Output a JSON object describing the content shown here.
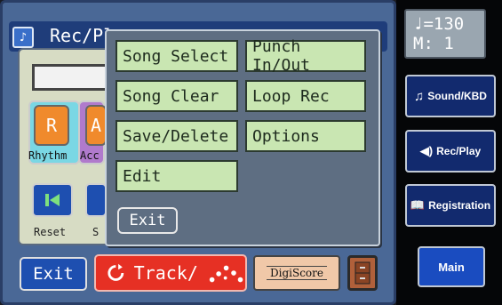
{
  "window": {
    "title": "Rec/Pl"
  },
  "parts": {
    "rhythm_key": "R",
    "accomp_key": "A",
    "rhythm_label": "Rhythm",
    "accomp_label": "Acc"
  },
  "transport": {
    "reset_label": "Reset",
    "s_label": "S"
  },
  "popup": {
    "items": [
      "Song Select",
      "Punch In/Out",
      "Song Clear",
      "Loop Rec",
      "Save/Delete",
      "Options",
      "Edit"
    ],
    "exit_label": "Exit"
  },
  "bottom": {
    "exit_label": "Exit",
    "track_label": "Track/",
    "digiscore_label": "DigiScore"
  },
  "status": {
    "tempo": "♩=130",
    "measure": "M:   1"
  },
  "side": {
    "sound_kbd": "Sound/KBD",
    "rec_play": "Rec/Play",
    "registration": "Registration",
    "main": "Main"
  },
  "colors": {
    "menu_item": "#c9e6b2",
    "track_button": "#e63024",
    "accent_blue": "#1e4fb0"
  }
}
